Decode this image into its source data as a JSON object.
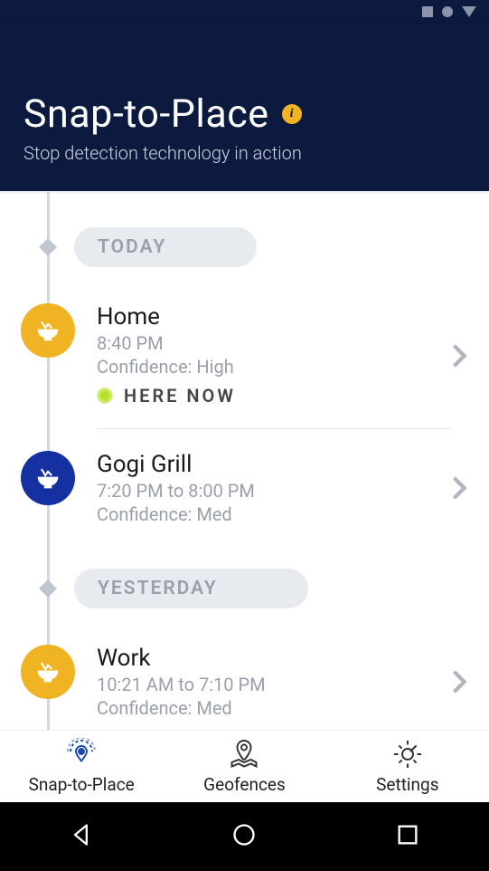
{
  "header": {
    "title": "Snap-to-Place",
    "subtitle": "Stop detection technology in action"
  },
  "sections": [
    {
      "label": "TODAY",
      "entries": [
        {
          "icon_color": "gold",
          "title": "Home",
          "time": "8:40 PM",
          "confidence": "Confidence: High",
          "here_now": "HERE NOW",
          "divider": true
        },
        {
          "icon_color": "blue",
          "title": "Gogi Grill",
          "time": "7:20 PM to 8:00 PM",
          "confidence": "Confidence: Med",
          "divider": false
        }
      ]
    },
    {
      "label": "YESTERDAY",
      "entries": [
        {
          "icon_color": "gold",
          "title": "Work",
          "time": "10:21 AM to 7:10 PM",
          "confidence": "Confidence: Med",
          "divider": false
        }
      ]
    }
  ],
  "nav": {
    "snap": "Snap-to-Place",
    "geo": "Geofences",
    "settings": "Settings"
  }
}
